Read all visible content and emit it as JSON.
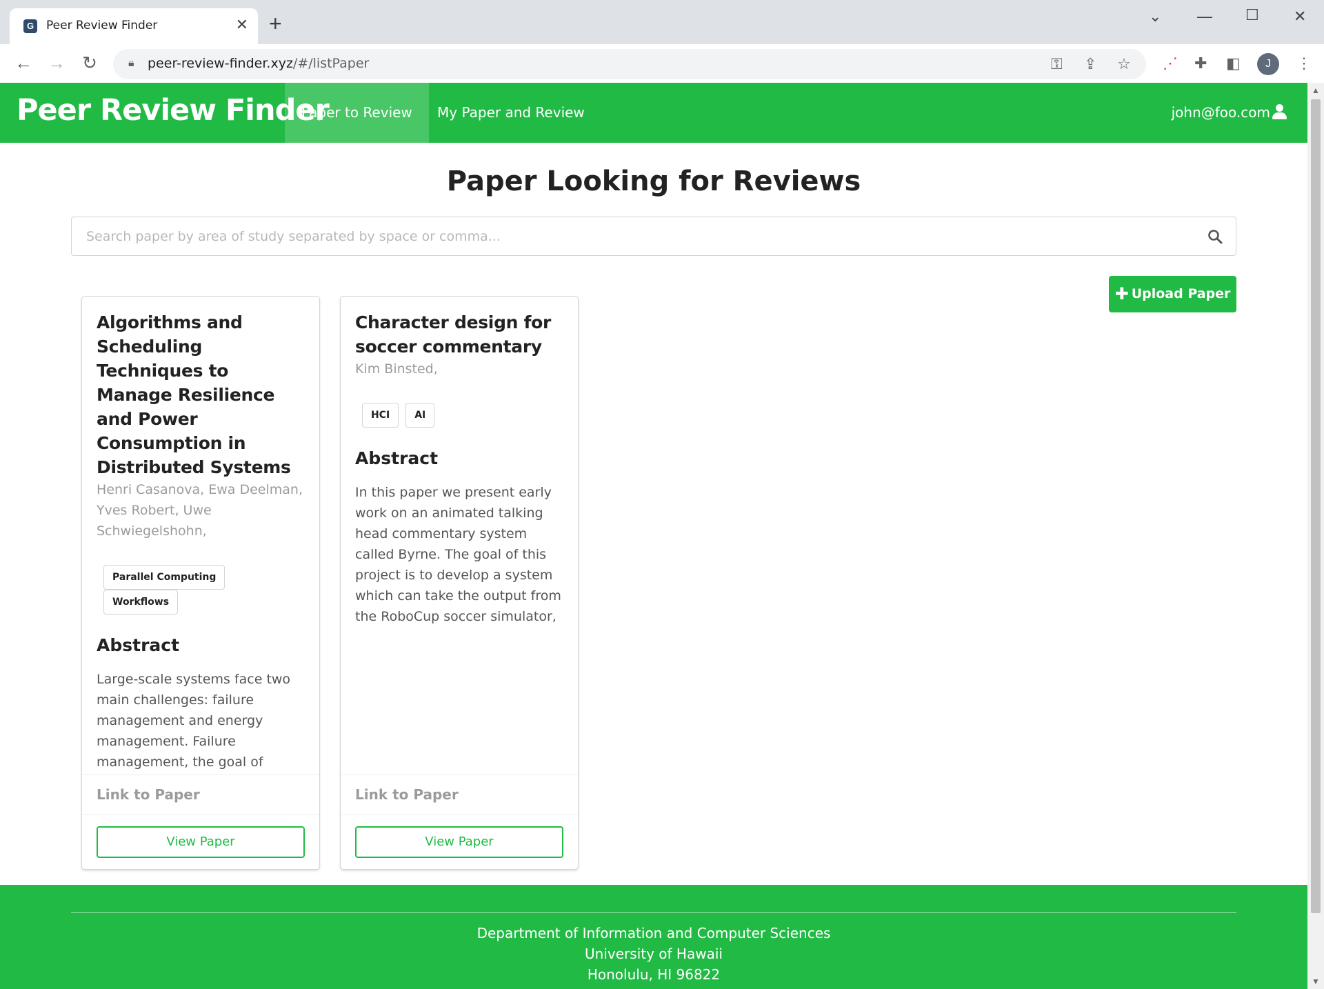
{
  "browser": {
    "tab_title": "Peer Review Finder",
    "tab_favicon": "favicon-icon",
    "url_domain": "peer-review-finder.xyz",
    "url_path": "/#/listPaper",
    "profile_initial": "J"
  },
  "nav": {
    "brand": "Peer Review Finder",
    "items": [
      {
        "label": "Paper to Review",
        "active": true
      },
      {
        "label": "My Paper and Review",
        "active": false
      }
    ],
    "user_email": "john@foo.com"
  },
  "page": {
    "heading": "Paper Looking for Reviews",
    "search_placeholder": "Search paper by area of study separated by space or comma...",
    "upload_label": "Upload Paper"
  },
  "papers": [
    {
      "title": "Algorithms and Scheduling Techniques to Manage Resilience and Power Consumption in Distributed Systems",
      "authors": "Henri Casanova, Ewa Deelman, Yves Robert, Uwe Schwiegelshohn,",
      "tags": [
        "Parallel Computing",
        "Workflows"
      ],
      "abstract_heading": "Abstract",
      "abstract": "Large-scale systems face two main challenges: failure management and energy management. Failure management, the goal of which is to achieve resilience, is necessary because a large number of hardware resources",
      "link_label": "Link to Paper",
      "button_label": "View Paper"
    },
    {
      "title": "Character design for soccer commentary",
      "authors": "Kim Binsted,",
      "tags": [
        "HCI",
        "AI"
      ],
      "abstract_heading": "Abstract",
      "abstract": "In this paper we present early work on an animated talking head commentary system called Byrne. The goal of this project is to develop a system which can take the output from the RoboCup soccer simulator, and generate appropriate affective",
      "link_label": "Link to Paper",
      "button_label": "View Paper"
    }
  ],
  "footer": {
    "line1": "Department of Information and Computer Sciences",
    "line2": "University of Hawaii",
    "line3": "Honolulu, HI 96822"
  },
  "colors": {
    "brand_green": "#21ba45",
    "chrome_bg": "#dee1e6"
  }
}
